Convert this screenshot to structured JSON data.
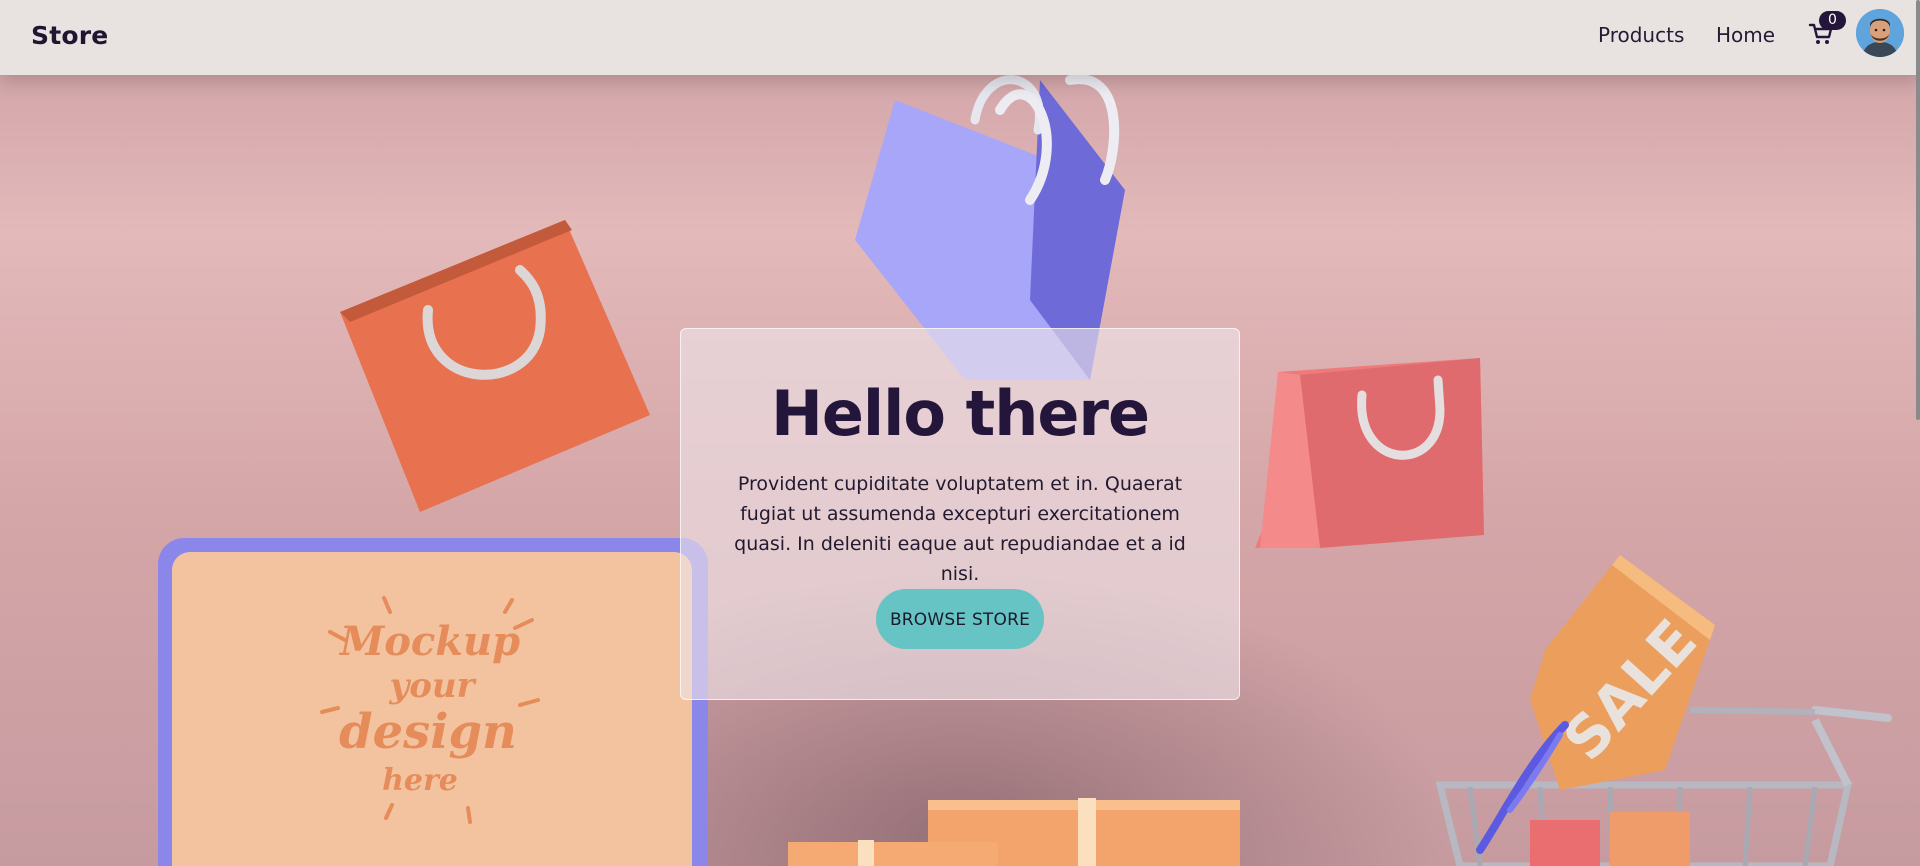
{
  "navbar": {
    "brand": "Store",
    "links": [
      "Products",
      "Home"
    ],
    "cart_count": "0"
  },
  "hero": {
    "title": "Hello there",
    "description": "Provident cupiditate voluptatem et in. Quaerat fugiat ut assumenda excepturi exercitationem quasi. In deleniti eaque aut repudiandae et a id nisi.",
    "button_label": "BROWSE STORE",
    "mockup_text": [
      "Mockup",
      "your",
      "design",
      "here"
    ],
    "sale_tag": "SALE"
  },
  "colors": {
    "navbar_bg": "#e8e2e1",
    "hero_bg": "#dcb3b6",
    "button": "#67c4c4",
    "title": "#24163a",
    "bag_orange": "#e8704f",
    "bag_purple": "#9a98f3",
    "bag_pink": "#e46e72",
    "laptop_frame": "#8b87ea",
    "laptop_screen": "#f3c4a0"
  },
  "icons": {
    "cart": "shopping-cart-icon",
    "avatar": "user-avatar-icon"
  }
}
